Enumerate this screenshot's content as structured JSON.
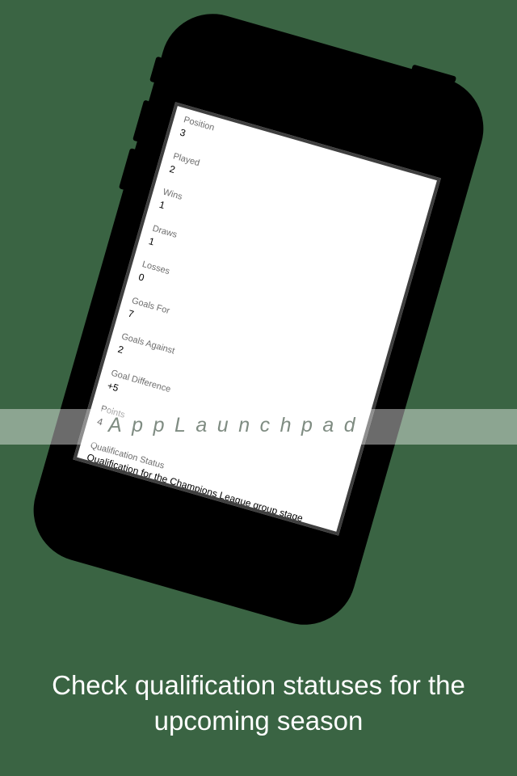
{
  "rows": [
    {
      "label": "Position",
      "value": "3"
    },
    {
      "label": "Played",
      "value": "2"
    },
    {
      "label": "Wins",
      "value": "1"
    },
    {
      "label": "Draws",
      "value": "1"
    },
    {
      "label": "Losses",
      "value": "0"
    },
    {
      "label": "Goals For",
      "value": "7"
    },
    {
      "label": "Goals Against",
      "value": "2"
    },
    {
      "label": "Goal Difference",
      "value": "+5"
    },
    {
      "label": "Points",
      "value": "4"
    },
    {
      "label": "Qualification Status",
      "value": "Qualification for the Champions League group stage"
    }
  ],
  "watermark": "AppLaunchpad",
  "caption": "Check qualification statuses for the upcoming season",
  "colors": {
    "background": "#3a6443",
    "phone_body": "#000000",
    "screen": "#ffffff",
    "caption_text": "#ffffff"
  }
}
